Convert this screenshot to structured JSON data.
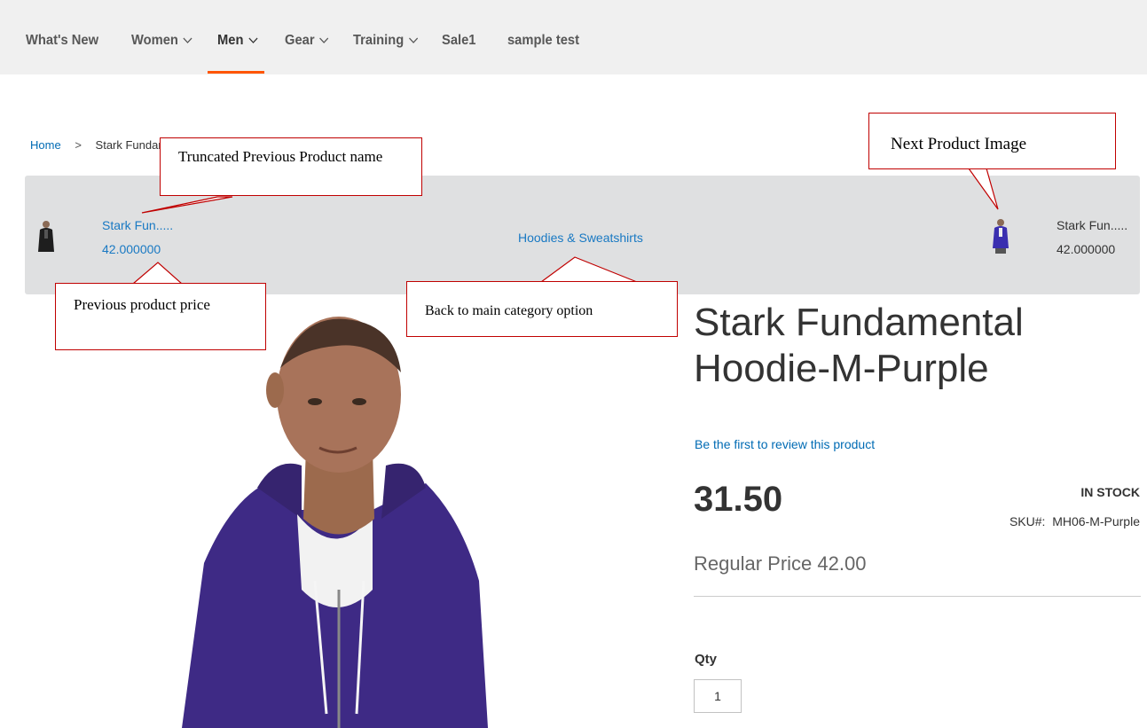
{
  "nav": {
    "items": [
      {
        "label": "What's New",
        "has_menu": false
      },
      {
        "label": "Women",
        "has_menu": true
      },
      {
        "label": "Men",
        "has_menu": true,
        "active": true
      },
      {
        "label": "Gear",
        "has_menu": true
      },
      {
        "label": "Training",
        "has_menu": true
      },
      {
        "label": "Sale1",
        "has_menu": false
      },
      {
        "label": "sample test",
        "has_menu": false
      }
    ],
    "accent_color": "#ff5501"
  },
  "breadcrumb": {
    "home": "Home",
    "separator": ">",
    "current": "Stark Fundam"
  },
  "prev_next": {
    "previous": {
      "name": "Stark Fun.....",
      "price": "42.000000",
      "thumb_icon": "black-hoodie-thumbnail"
    },
    "category_link": "Hoodies & Sweatshirts",
    "next": {
      "name": "Stark Fun.....",
      "price": "42.000000",
      "thumb_icon": "purple-hoodie-thumbnail"
    }
  },
  "annotations": {
    "truncated_name": "Truncated Previous Product name",
    "previous_price": "Previous product price",
    "back_to_category": "Back to main category option",
    "next_image": "Next Product Image",
    "color": "#c00000"
  },
  "product": {
    "title": "Stark Fundamental Hoodie-M-Purple",
    "review_link": "Be the first to review this product",
    "price": "31.50",
    "stock": "IN STOCK",
    "sku_label": "SKU#:",
    "sku_value": "MH06-M-Purple",
    "regular_price": "Regular Price 42.00",
    "qty_label": "Qty",
    "qty_value": "1",
    "image_icon": "product-model-photo"
  }
}
